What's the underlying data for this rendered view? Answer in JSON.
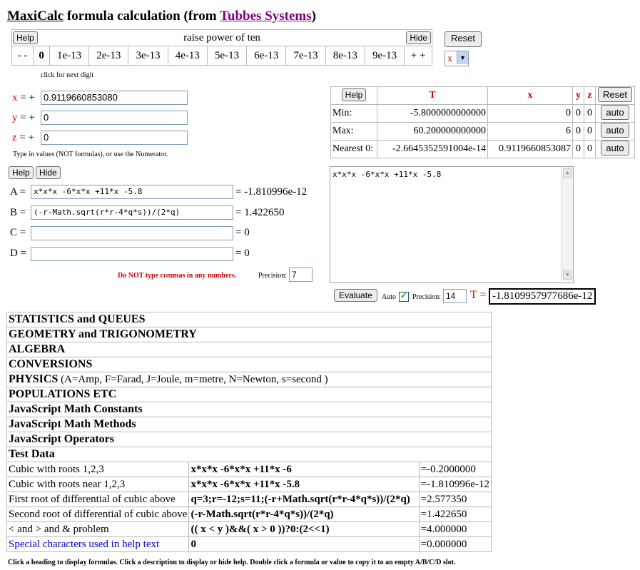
{
  "title": {
    "app": "MaxiCalc",
    "middle": " formula calculation (from ",
    "company": "Tubbes Systems",
    "end": ")"
  },
  "power": {
    "help": "Help",
    "heading": "raise power of ten",
    "hide": "Hide",
    "cells": [
      "- -",
      "0",
      "1e-13",
      "2e-13",
      "3e-13",
      "4e-13",
      "5e-13",
      "6e-13",
      "7e-13",
      "8e-13",
      "9e-13",
      "+ +"
    ],
    "selected": "0",
    "hint": "click for next digit"
  },
  "reset_label": "Reset",
  "var_select": {
    "value": "x"
  },
  "vars": {
    "x": {
      "label": "x",
      "sign": "= +",
      "value": "0.9119660853080"
    },
    "y": {
      "label": "y",
      "sign": "= +",
      "value": "0"
    },
    "z": {
      "label": "z",
      "sign": "= +",
      "value": "0"
    },
    "note": "Type in values (NOT formulas), or use the Numerator."
  },
  "formula_panel": {
    "help": "Help",
    "hide": "Hide"
  },
  "formulas": [
    {
      "label": "A =",
      "value": "x*x*x -6*x*x +11*x -5.8",
      "result": "= -1.810996e-12"
    },
    {
      "label": "B =",
      "value": "(-r-Math.sqrt(r*r-4*q*s))/(2*q)",
      "result": "= 1.422650"
    },
    {
      "label": "C =",
      "value": "",
      "result": "= 0"
    },
    {
      "label": "D =",
      "value": "",
      "result": "= 0"
    }
  ],
  "warning": "Do NOT type commas in any numbers.",
  "precision_label": "Precision:",
  "precision_value": "7",
  "range": {
    "help": "Help",
    "headers": {
      "t": "T",
      "x": "x",
      "y": "y",
      "z": "z"
    },
    "reset": "Reset",
    "rows": [
      {
        "label": "Min:",
        "t": "-5.8000000000000",
        "x": "0",
        "y": "0",
        "z": "0",
        "btn": "auto"
      },
      {
        "label": "Max:",
        "t": "60.200000000000",
        "x": "6",
        "y": "0",
        "z": "0",
        "btn": "auto"
      },
      {
        "label": "Nearest 0:",
        "t": "-2.6645352591004e-14",
        "x": "0.9119660853087",
        "y": "0",
        "z": "0",
        "btn": "auto"
      }
    ]
  },
  "editor": {
    "text": "x*x*x -6*x*x +11*x -5.8"
  },
  "evaluate": {
    "button": "Evaluate",
    "auto": "Auto",
    "precision_label": "Precision:",
    "precision_value": "14",
    "t_label": "T =",
    "t_value": "-1.8109957977686e-12"
  },
  "sections": [
    {
      "title": "STATISTICS and QUEUES"
    },
    {
      "title": "GEOMETRY and TRIGONOMETRY"
    },
    {
      "title": "ALGEBRA"
    },
    {
      "title": "CONVERSIONS"
    },
    {
      "title": "PHYSICS",
      "note": " (A=Amp, F=Farad, J=Joule, m=metre, N=Newton, s=second )"
    },
    {
      "title": "POPULATIONS ETC"
    },
    {
      "title": "JavaScript Math Constants"
    },
    {
      "title": "JavaScript Math Methods"
    },
    {
      "title": "JavaScript Operators"
    },
    {
      "title": "Test Data"
    }
  ],
  "test_rows": [
    {
      "desc": "Cubic with roots 1,2,3",
      "formula": "x*x*x -6*x*x +11*x -6",
      "value": "=-0.2000000"
    },
    {
      "desc": "Cubic with roots near 1,2,3",
      "formula": "x*x*x -6*x*x +11*x -5.8",
      "value": "=-1.810996e-12"
    },
    {
      "desc": "First root of differential of cubic above",
      "formula": "q=3;r=-12;s=11;(-r+Math.sqrt(r*r-4*q*s))/(2*q)",
      "value": "=2.577350"
    },
    {
      "desc": "Second root of differential of cubic above",
      "formula": "(-r-Math.sqrt(r*r-4*q*s))/(2*q)",
      "value": "=1.422650"
    },
    {
      "desc": "< and > and & problem",
      "formula": "(( x < y )&&( x > 0 ))?0:(2<<1)",
      "value": "=4.000000"
    },
    {
      "desc": "Special characters used in help text",
      "formula": "0",
      "value": "=0.000000"
    }
  ],
  "footer": "Click a heading to display formulas. Click a description to display or hide help. Double click a formula or value to copy it to an empty A/B/C/D slot."
}
